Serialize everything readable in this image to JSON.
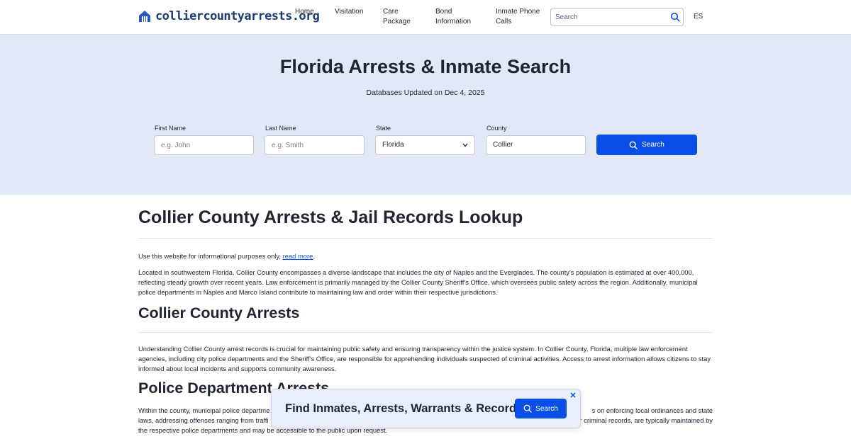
{
  "header": {
    "logo_text": "colliercountyarrests.org",
    "nav": [
      {
        "line1": "Home",
        "line2": ""
      },
      {
        "line1": "Visitation",
        "line2": ""
      },
      {
        "line1": "Care",
        "line2": "Package"
      },
      {
        "line1": "Bond",
        "line2": "Information"
      },
      {
        "line1": "Inmate Phone",
        "line2": "Calls"
      }
    ],
    "search_placeholder": "Search",
    "lang": "ES"
  },
  "hero": {
    "title": "Florida Arrests & Inmate Search",
    "subtitle": "Databases Updated on Dec 4, 2025",
    "first_name_label": "First Name",
    "first_name_placeholder": "e.g. John",
    "last_name_label": "Last Name",
    "last_name_placeholder": "e.g. Smith",
    "state_label": "State",
    "state_value": "Florida",
    "county_label": "County",
    "county_value": "Collier",
    "search_button": "Search"
  },
  "content": {
    "title": "Collier County Arrests & Jail Records Lookup",
    "disclaimer_text": "Use this website for informational purposes only, ",
    "disclaimer_link": "read more",
    "disclaimer_end": ".",
    "intro": "Located in southwestern Florida, Collier County encompasses a diverse landscape that includes the city of Naples and the Everglades. The county's population is estimated at over 400,000, reflecting steady growth over recent years. Law enforcement is primarily managed by the Collier County Sheriff's Office, which oversees public safety across the region. Additionally, municipal police departments in Naples and Marco Island contribute to maintaining law and order within their respective jurisdictions.",
    "arrests_heading": "Collier County Arrests",
    "arrests_text": "Understanding Collier County arrest records is crucial for maintaining public safety and ensuring transparency within the justice system. In Collier County, Florida, multiple law enforcement agencies, including city police departments and the Sheriff's Office, are responsible for apprehending individuals suspected of criminal activities. Access to arrest information allows citizens to stay informed about local incidents and supports community awareness.",
    "police_heading": "Police Department Arrests",
    "police_line1_left": "Within the county, municipal police departme",
    "police_line1_right": "s on enforcing local ordinances and state",
    "police_line2_left": "laws, addressing offenses ranging from traffi",
    "police_line2_right": "r criminal records, are typically maintained by",
    "police_line3": "the respective police departments and may be accessible to the public upon request."
  },
  "banner": {
    "text": "Find Inmates, Arrests, Warrants & Records",
    "button": "Search"
  },
  "colors": {
    "primary": "#0a4ee8",
    "hero_bg": "#e2e8f6",
    "logo": "#1f3b73"
  }
}
